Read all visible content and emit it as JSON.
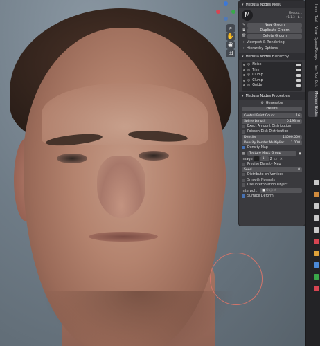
{
  "colors": {
    "accent": "#4772b3",
    "panel_bg": "#3a3a3e",
    "brush_ring": "#d2756b"
  },
  "viewport": {
    "gizmo": {
      "x_color": "#3c78d8",
      "y_color": "#d64552",
      "z_color": "#3aa84a"
    },
    "tools": [
      {
        "icon": "zoom-icon",
        "glyph": "⌕"
      },
      {
        "icon": "hand-icon",
        "glyph": "✋"
      },
      {
        "icon": "camera-icon",
        "glyph": "◉"
      },
      {
        "icon": "grid-icon",
        "glyph": "⊞"
      }
    ]
  },
  "menu": {
    "title": "Medusa Nodes Menu",
    "logo": "M",
    "version_line1": "Medusa...",
    "version_line2": "v1.1.3 - b...",
    "new_groom": "New Groom",
    "duplicate_groom": "Duplicate Groom",
    "delete_groom": "Delete Groom",
    "viewport_rendering": "Viewport & Rendering",
    "hierarchy_options": "Hierarchy Options"
  },
  "hierarchy": {
    "title": "Medusa Nodes Hierarchy",
    "items": [
      {
        "label": "Noise"
      },
      {
        "label": "Trim"
      },
      {
        "label": "Clump 1"
      },
      {
        "label": "Clump"
      },
      {
        "label": "Guide"
      }
    ]
  },
  "properties": {
    "title": "Medusa Nodes Properties",
    "node_name": "Generator",
    "freeze": "Freeze",
    "control_point_count_label": "Control Point Count",
    "control_point_count": "16",
    "spline_length_label": "Spline Length",
    "spline_length": "0.193 m",
    "exact_amount": "Exact Amount Distribution",
    "poisson_disk": "Poisson Disk Distribution",
    "density_label": "Density",
    "density": "14000.000",
    "density_mult_label": "Density Render Multiplier",
    "density_mult": "1.000",
    "density_map": "Density Map",
    "texture_mask": "Texture Mask Group",
    "image_label": "Image",
    "image_value": "1",
    "image_users": "2",
    "precise_density": "Precise Density Map",
    "seed_label": "Seed",
    "seed": "0",
    "distribute_vertices": "Distribute on Vertices",
    "smooth_normals": "Smooth Normals",
    "use_interp": "Use Interpolation Object",
    "interp_label": "Interpol...",
    "interp_placeholder": "Object",
    "surface_deform": "Surface Deform"
  },
  "tabs": [
    "Item",
    "Tool",
    "View",
    "SpeedRetopo",
    "Hair Tool",
    "Edit",
    "Medusa Nodes"
  ]
}
